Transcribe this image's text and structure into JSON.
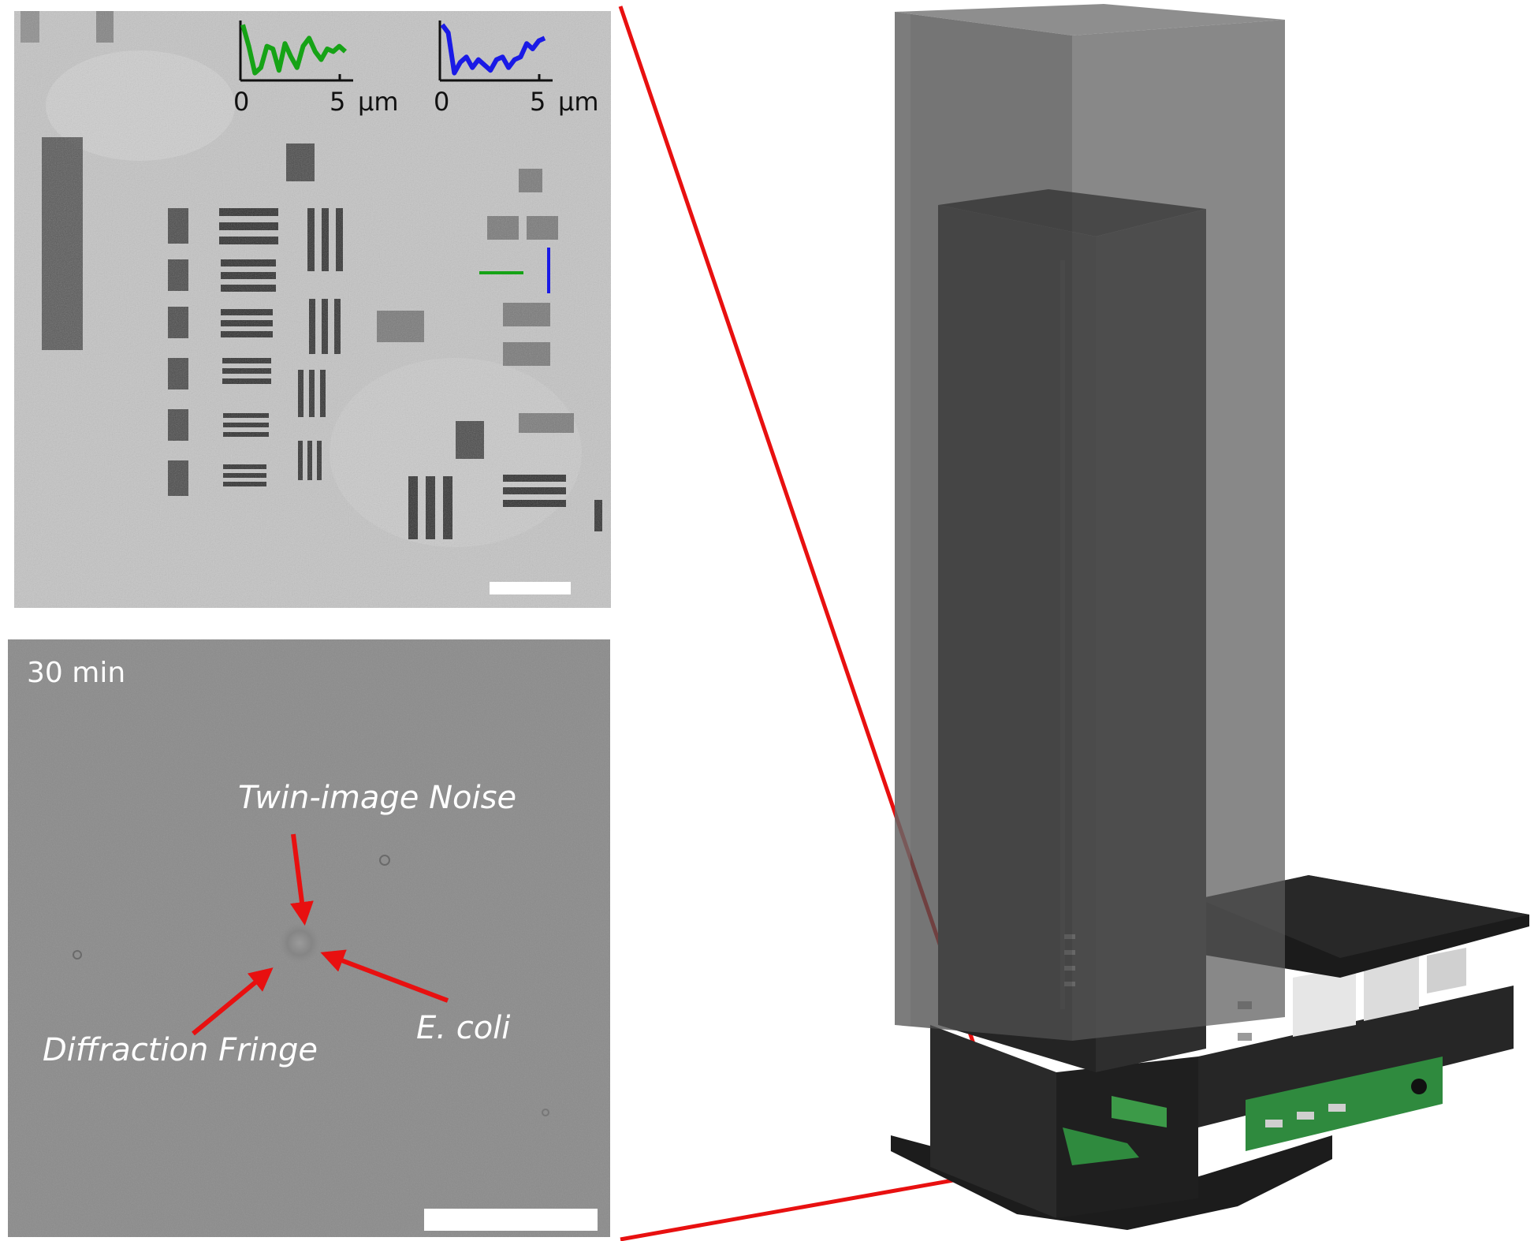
{
  "colors": {
    "profile_horizontal": "#16a316",
    "profile_vertical": "#1a1ae6",
    "connector_red": "#e81010",
    "annotation_arrow": "#e81010",
    "scalebar": "#ffffff",
    "device_dark": "#2a2a2a",
    "device_shell": "#6e6e6e",
    "pcb_green": "#2f8a3e"
  },
  "resolution_panel": {
    "profile_plot_green": {
      "x_tick_0": "0",
      "x_tick_5": "5",
      "x_unit": "μm",
      "profile_values": [
        0.95,
        0.55,
        0.05,
        0.15,
        0.55,
        0.5,
        0.1,
        0.6,
        0.35,
        0.15,
        0.55,
        0.7,
        0.45,
        0.3,
        0.5,
        0.45,
        0.55,
        0.45
      ]
    },
    "profile_plot_blue": {
      "x_tick_0": "0",
      "x_tick_5": "5",
      "x_unit": "μm",
      "profile_values": [
        0.95,
        0.8,
        0.05,
        0.25,
        0.35,
        0.15,
        0.3,
        0.2,
        0.1,
        0.3,
        0.35,
        0.15,
        0.3,
        0.35,
        0.6,
        0.5,
        0.65,
        0.7
      ]
    }
  },
  "ecoli_panel": {
    "time_label": "30 min",
    "annotations": {
      "twin_image_noise": "Twin-image Noise",
      "diffraction_fringe": "Diffraction Fringe",
      "e_coli": "E. coli"
    }
  },
  "device_render": {
    "icon": "lensfree-holographic-microscope-render"
  }
}
